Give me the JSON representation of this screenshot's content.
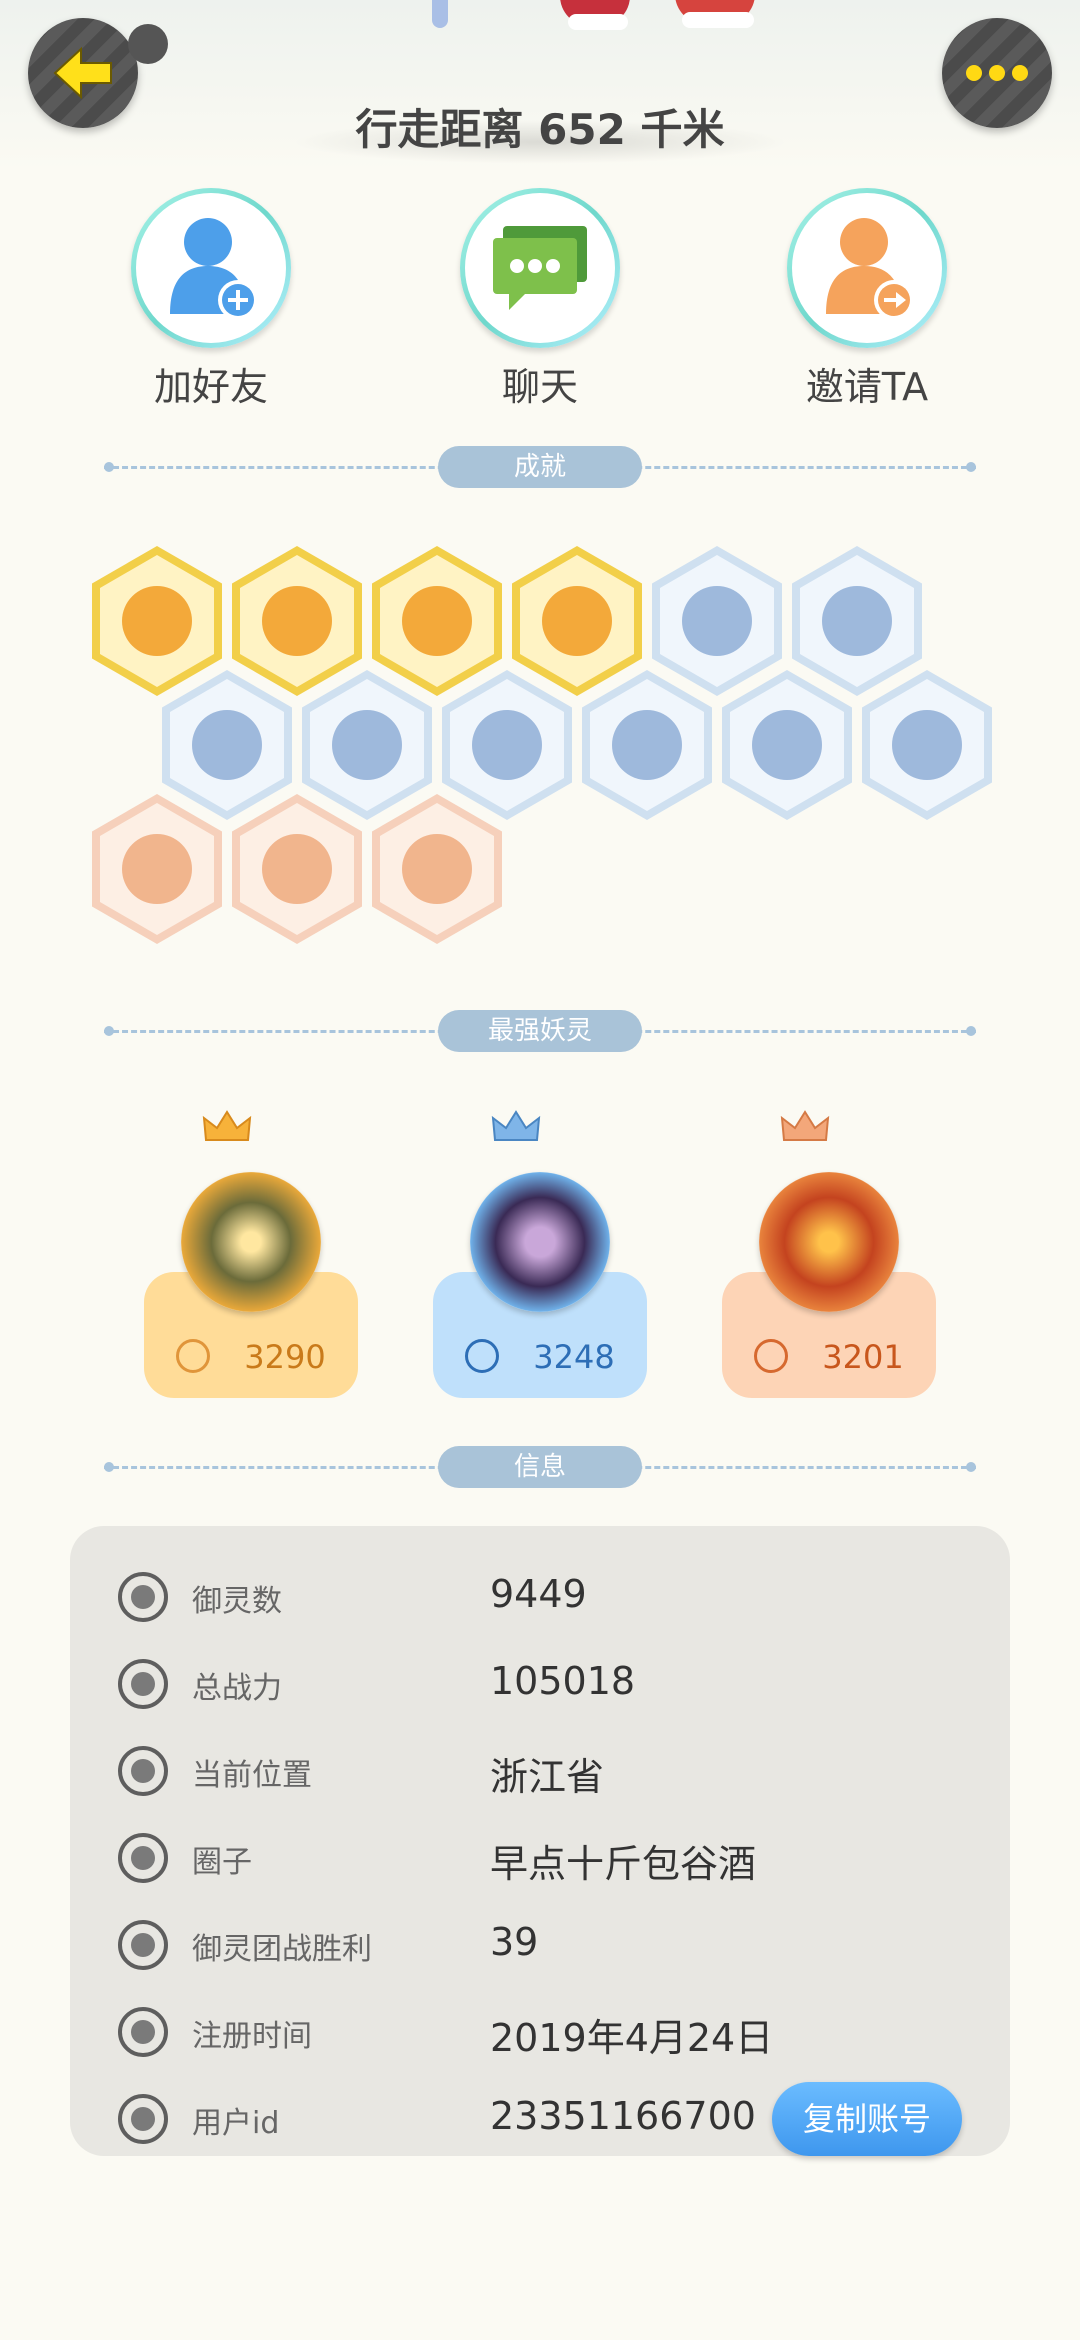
{
  "header": {
    "distance": "行走距离 652 千米"
  },
  "actions": [
    {
      "label": "加好友"
    },
    {
      "label": "聊天"
    },
    {
      "label": "邀请TA"
    }
  ],
  "sections": {
    "achievements": "成就",
    "strongest": "最强妖灵",
    "info": "信息"
  },
  "achievements": [
    {
      "tier": "gold",
      "icon": "cat-moon-badge"
    },
    {
      "tier": "gold",
      "icon": "bun-badge"
    },
    {
      "tier": "gold",
      "icon": "swirl-orb-badge"
    },
    {
      "tier": "gold",
      "icon": "fox-flower-badge"
    },
    {
      "tier": "blue",
      "icon": "sneaker-badge"
    },
    {
      "tier": "blue",
      "icon": "magnifier-badge"
    },
    {
      "tier": "blue",
      "icon": "moon-orb-badge"
    },
    {
      "tier": "blue",
      "icon": "crystal-badge"
    },
    {
      "tier": "blue",
      "icon": "spirit-figure-badge"
    },
    {
      "tier": "blue",
      "icon": "yinyang-badge"
    },
    {
      "tier": "blue",
      "icon": "fish-spirit-badge"
    },
    {
      "tier": "blue",
      "icon": "book-fox-badge"
    },
    {
      "tier": "peach",
      "icon": "stroller-cat-badge"
    },
    {
      "tier": "peach",
      "icon": "scroll-badge"
    },
    {
      "tier": "peach",
      "icon": "horned-spirit-badge"
    }
  ],
  "spirits": [
    {
      "power": "3290",
      "color": "#ffdc98",
      "accent": "#f1a443"
    },
    {
      "power": "3248",
      "color": "#bfe0fb",
      "accent": "#3e7fc8"
    },
    {
      "power": "3201",
      "color": "#fdd4b6",
      "accent": "#e0723c"
    }
  ],
  "info": {
    "rows": [
      {
        "label": "御灵数",
        "value": "9449",
        "icon": "spirit-count-icon"
      },
      {
        "label": "总战力",
        "value": "105018",
        "icon": "sword-icon"
      },
      {
        "label": "当前位置",
        "value": "浙江省",
        "icon": "location-pin-icon"
      },
      {
        "label": "圈子",
        "value": "早点十斤包谷酒",
        "icon": "circle-group-icon"
      },
      {
        "label": "御灵团战胜利",
        "value": "39",
        "icon": "anchor-icon"
      },
      {
        "label": "注册时间",
        "value": "2019年4月24日",
        "icon": "clock-icon"
      },
      {
        "label": "用户id",
        "value": "23351166700",
        "icon": "id-card-icon"
      }
    ],
    "copy_button": "复制账号"
  }
}
